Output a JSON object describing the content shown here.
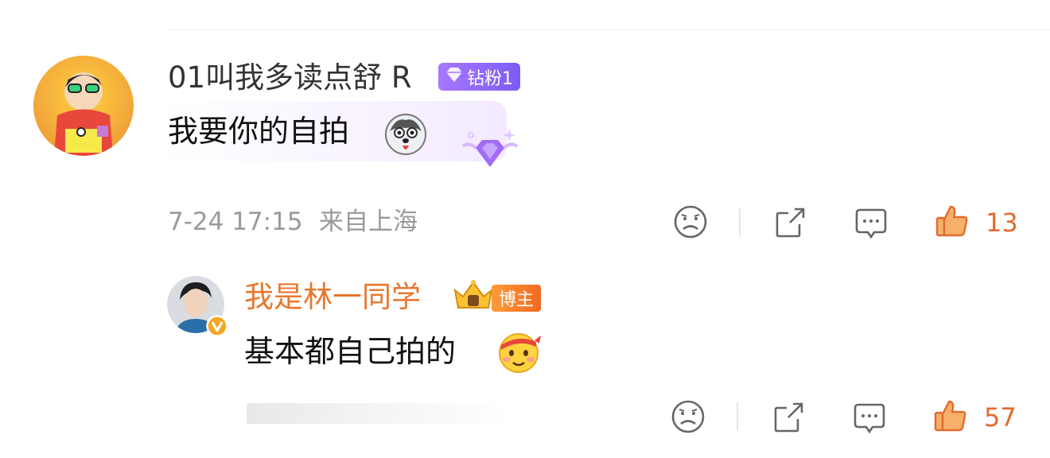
{
  "comment": {
    "username": "01叫我多读点舒 R",
    "badge": "钻粉1",
    "text": "我要你的自拍",
    "emoji": "husky-emoji",
    "decoration": "diamond-fan-icon",
    "time": "7-24 17:15",
    "location": "来自上海",
    "likes": "13"
  },
  "reply": {
    "username": "我是林一同学",
    "badge": "博主",
    "text": "基本都自己拍的",
    "emoji": "blushing-emoji",
    "likes": "57"
  },
  "colors": {
    "accent_orange": "#e8772e",
    "like_orange": "#e26b2c",
    "diamond_purple": "#8f63f7",
    "meta_gray": "#9a9a9a"
  }
}
